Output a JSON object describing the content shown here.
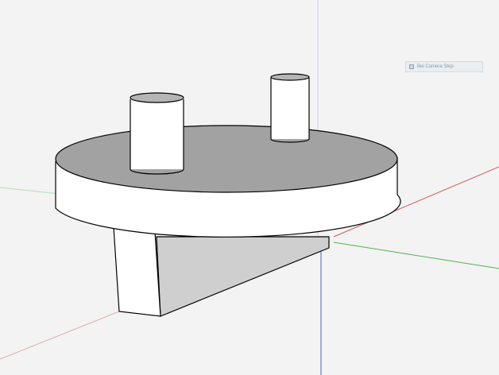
{
  "viewport": {
    "background": "#f3f3f3",
    "model_fill": "#ffffff",
    "model_shade": "#9c9c9c",
    "edge_color": "#000000"
  },
  "axes": {
    "red": "#d35a5a",
    "green": "#55b055",
    "blue": "#5a5ad0"
  },
  "tooltip": {
    "icon": "cursor-tool-icon",
    "text": "Bei Camera Step"
  }
}
